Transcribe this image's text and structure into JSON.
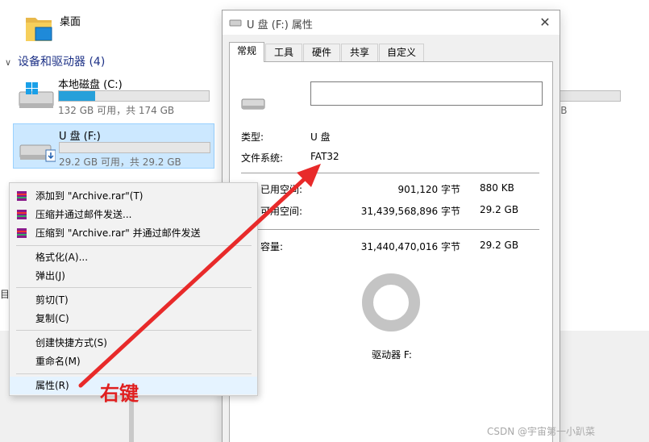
{
  "explorer": {
    "desktop_label": "桌面",
    "group_header": "设备和驱动器 (4)",
    "drives": [
      {
        "name": "本地磁盘 (C:)",
        "size_text": "132 GB 可用，共 174 GB",
        "used_fraction": 0.24
      },
      {
        "name": "U 盘 (F:)",
        "size_text": "29.2 GB 可用，共 29.2 GB",
        "used_fraction": 0.0
      }
    ],
    "right_drive_size": "GB",
    "left_edge_char": "目"
  },
  "dialog": {
    "title": "U 盘 (F:) 属性",
    "close_glyph": "✕",
    "tabs": [
      "常规",
      "工具",
      "硬件",
      "共享",
      "自定义"
    ],
    "name_value": "",
    "type_label": "类型:",
    "type_value": "U 盘",
    "fs_label": "文件系统:",
    "fs_value": "FAT32",
    "used_label": "已用空间:",
    "used_bytes": "901,120 字节",
    "used_human": "880 KB",
    "free_label": "可用空间:",
    "free_bytes": "31,439,568,896 字节",
    "free_human": "29.2 GB",
    "capacity_label": "容量:",
    "capacity_bytes": "31,440,470,016 字节",
    "capacity_human": "29.2 GB",
    "drive_label": "驱动器 F:"
  },
  "context_menu": {
    "items": [
      {
        "label": "添加到 \"Archive.rar\"(T)",
        "icon": "winrar-icon"
      },
      {
        "label": "压缩并通过邮件发送...",
        "icon": "winrar-icon"
      },
      {
        "label": "压缩到 \"Archive.rar\" 并通过邮件发送",
        "icon": "winrar-icon"
      },
      {
        "label": "格式化(A)..."
      },
      {
        "label": "弹出(J)"
      },
      {
        "label": "剪切(T)"
      },
      {
        "label": "复制(C)"
      },
      {
        "label": "创建快捷方式(S)"
      },
      {
        "label": "重命名(M)"
      },
      {
        "label": "属性(R)"
      }
    ]
  },
  "annotation": {
    "text": "右键",
    "color": "#e02020"
  },
  "watermark": "CSDN @宇宙第一小趴菜",
  "colors": {
    "accent": "#26a0da",
    "selection": "#cce8ff",
    "used_swatch": "#1f7cd1",
    "free_swatch": "#c8c8c8"
  }
}
